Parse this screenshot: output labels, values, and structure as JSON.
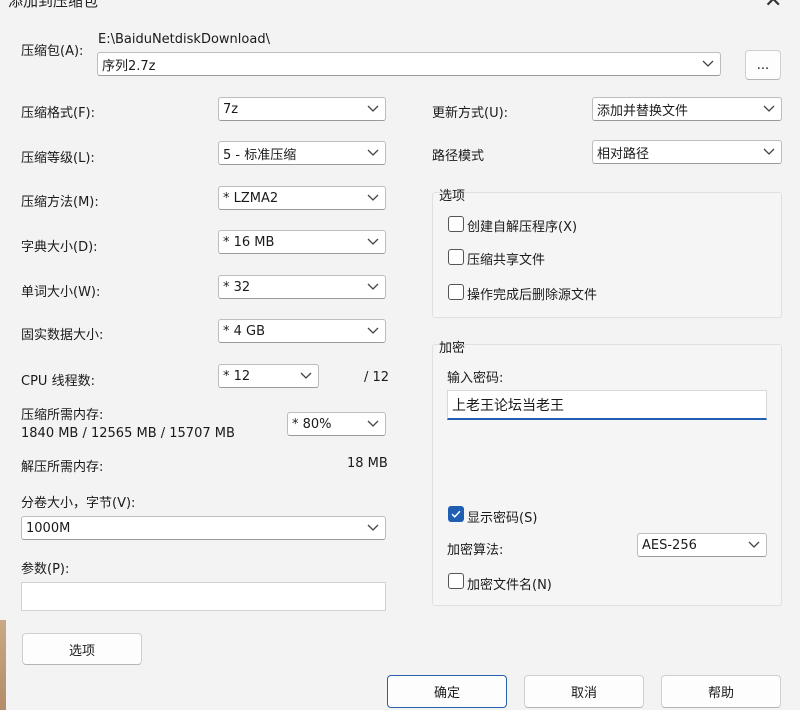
{
  "window": {
    "title": "添加到压缩包",
    "close_glyph": "✕"
  },
  "archive": {
    "label": "压缩包(A):",
    "path": "E:\\BaiduNetdiskDownload\\",
    "filename": "序列2.7z",
    "browse_label": "..."
  },
  "left": {
    "format": {
      "label": "压缩格式(F):",
      "value": "7z"
    },
    "level": {
      "label": "压缩等级(L):",
      "value": "5 - 标准压缩"
    },
    "method": {
      "label": "压缩方法(M):",
      "value": "* LZMA2"
    },
    "dict": {
      "label": "字典大小(D):",
      "value": "* 16 MB"
    },
    "word": {
      "label": "单词大小(W):",
      "value": "* 32"
    },
    "solid": {
      "label": "固实数据大小:",
      "value": "* 4 GB"
    },
    "threads": {
      "label": "CPU 线程数:",
      "value": "* 12",
      "max": "/ 12"
    },
    "mem_compress": {
      "label": "压缩所需内存:",
      "detail": "1840 MB / 12565 MB / 15707 MB",
      "value": "* 80%"
    },
    "mem_decompress": {
      "label": "解压所需内存:",
      "value": "18 MB"
    },
    "volume": {
      "label": "分卷大小，字节(V):",
      "value": "1000M"
    },
    "params": {
      "label": "参数(P):",
      "value": ""
    },
    "options_button": "选项"
  },
  "right": {
    "update": {
      "label": "更新方式(U):",
      "value": "添加并替换文件"
    },
    "pathmode": {
      "label": "路径模式",
      "value": "相对路径"
    },
    "options_group": {
      "title": "选项",
      "items": [
        {
          "label": "创建自解压程序(X)",
          "checked": false
        },
        {
          "label": "压缩共享文件",
          "checked": false
        },
        {
          "label": "操作完成后删除源文件",
          "checked": false
        }
      ]
    },
    "encryption": {
      "title": "加密",
      "password_label": "输入密码:",
      "password_value": "上老王论坛当老王",
      "show_password": {
        "label": "显示密码(S)",
        "checked": true
      },
      "method_label": "加密算法:",
      "method_value": "AES-256",
      "encrypt_names": {
        "label": "加密文件名(N)",
        "checked": false
      }
    }
  },
  "buttons": {
    "ok": "确定",
    "cancel": "取消",
    "help": "帮助"
  },
  "colors": {
    "accent": "#1f5eb3",
    "background": "#f3f3f3"
  }
}
